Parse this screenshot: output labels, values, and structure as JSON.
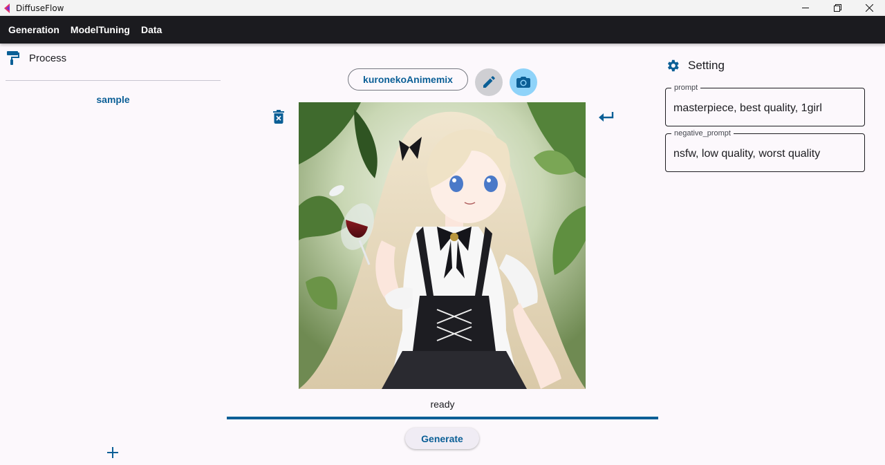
{
  "window": {
    "title": "DiffuseFlow"
  },
  "menu": {
    "items": [
      "Generation",
      "ModelTuning",
      "Data"
    ]
  },
  "process": {
    "title": "Process",
    "items": [
      "sample"
    ]
  },
  "model": {
    "name": "kuronekoAnimemix"
  },
  "image": {
    "description_icon": "generated-anime-girl-image"
  },
  "status": {
    "text": "ready",
    "progress": 1.0
  },
  "actions": {
    "generate_label": "Generate"
  },
  "setting": {
    "title": "Setting",
    "prompt_label": "prompt",
    "prompt_value": "masterpiece, best quality, 1girl",
    "negative_label": "negative_prompt",
    "negative_value": "nsfw, low quality, worst quality"
  },
  "colors": {
    "accent": "#0b5f96",
    "menubar": "#1b1b1f",
    "camera_bg": "#8fd3f9"
  }
}
